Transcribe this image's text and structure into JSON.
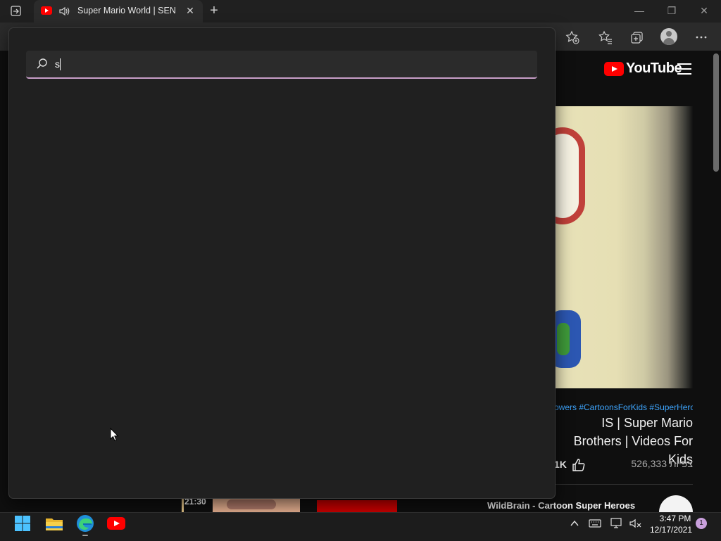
{
  "browser": {
    "tab": {
      "title": "Super Mario World | SEND"
    },
    "tab_close": "✕",
    "new_tab": "+",
    "window": {
      "minimize": "—",
      "maximize": "❐",
      "close": "✕"
    }
  },
  "youtube": {
    "logo_text": "YouTube",
    "hashtags": "owers #CartoonsForKids #SuperHero",
    "video_title": "IS | Super Mario Brothers | Videos For Kids",
    "likes": "1K",
    "views": "526,333 צפיות",
    "next_duration": "21:30",
    "next_channel": "WildBrain - Cartoon Super Heroes"
  },
  "search": {
    "value": "s",
    "icon": "search-icon",
    "focus_color": "#c89ec8"
  },
  "taskbar": {
    "time": "3:47 PM",
    "date": "12/17/2021",
    "notification_count": "1",
    "apps": [
      "start-icon",
      "file-explorer-icon",
      "edge-icon",
      "youtube-icon"
    ]
  }
}
